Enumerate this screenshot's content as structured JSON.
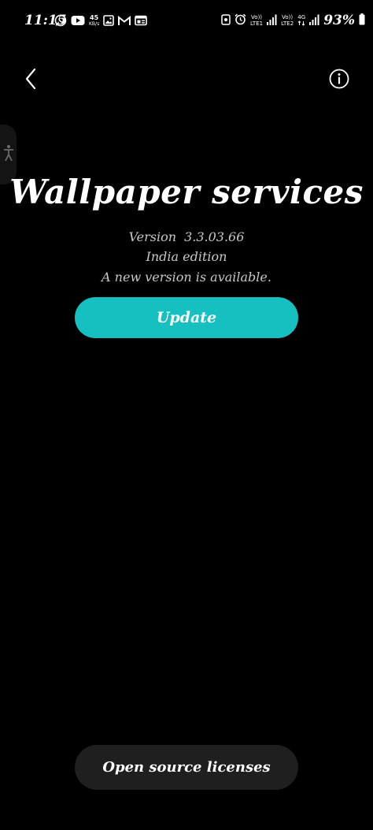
{
  "status_bar": {
    "time": "11:15",
    "left_icons": [
      "whatsapp-icon",
      "youtube-icon",
      "image-icon",
      "gmail-icon",
      "news-icon"
    ],
    "net_speed_value": "45",
    "net_speed_unit": "KB/s",
    "sim1_label_top": "Vo))",
    "sim1_label_bottom": "LTE1",
    "sim2_label_top": "Vo))",
    "sim2_label_bottom": "LTE2",
    "network_type": "4G",
    "battery_percent": "93%"
  },
  "app_bar": {
    "back_icon": "chevron-left-icon",
    "info_icon": "info-circle-icon"
  },
  "main": {
    "title": "Wallpaper services",
    "version_label": "Version",
    "version_number": "3.3.03.66",
    "edition": "India edition",
    "update_status": "A new version is available.",
    "update_button_label": "Update",
    "licenses_button_label": "Open source licenses"
  },
  "colors": {
    "background": "#000000",
    "accent": "#16bfc0",
    "secondary_button": "#1f1f1f",
    "muted_text": "#c8c8c8"
  }
}
